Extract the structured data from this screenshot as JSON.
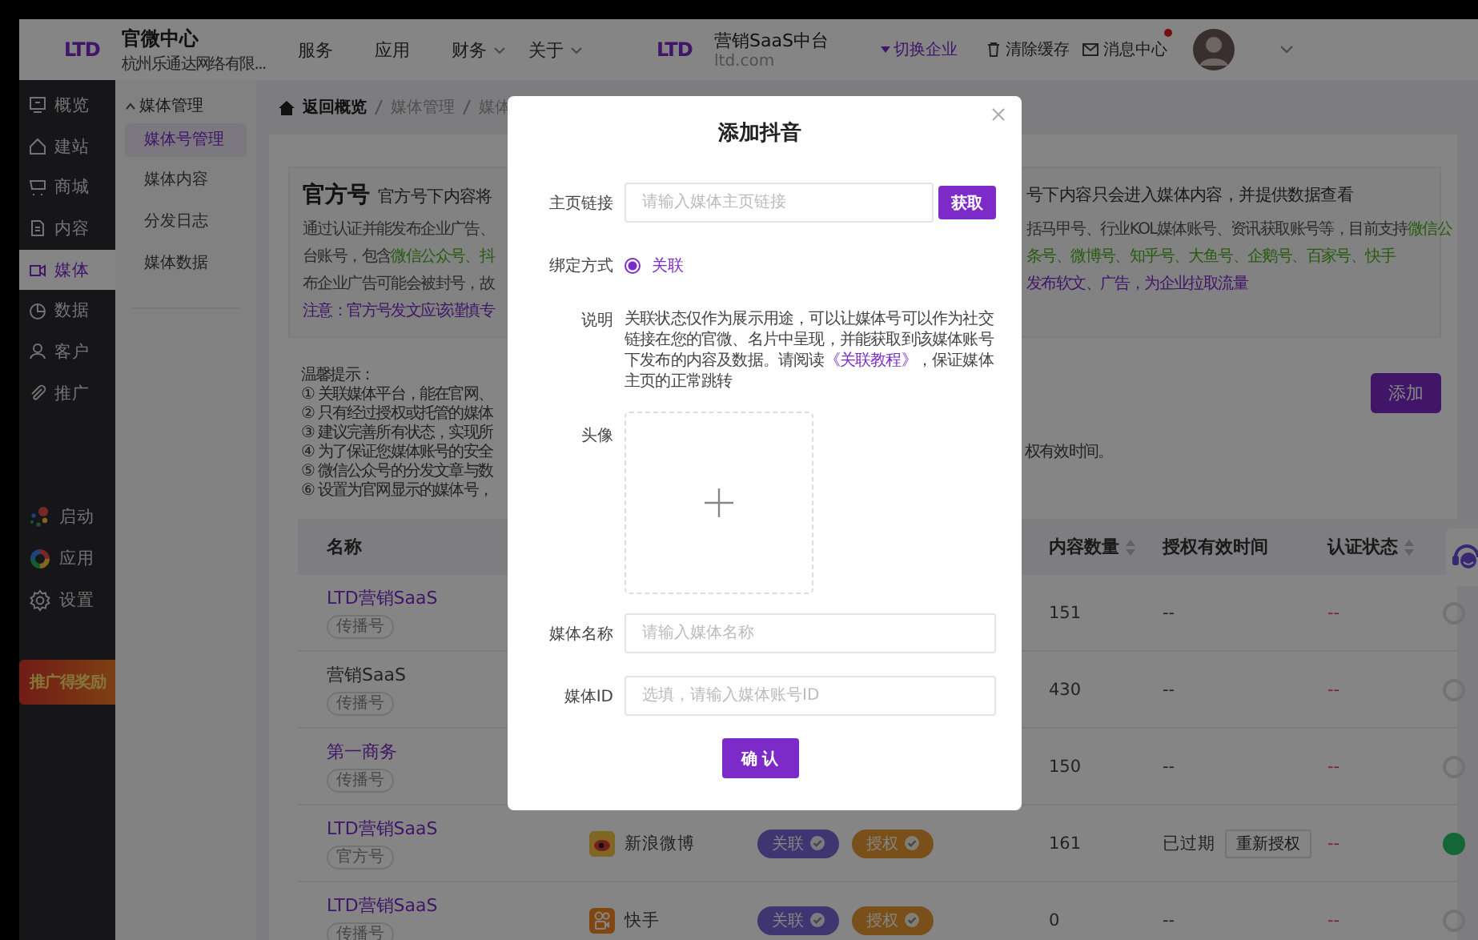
{
  "topbar": {
    "logo": "LTD",
    "brand_title": "官微中心",
    "brand_subtitle": "杭州乐通达网络有限...",
    "nav": [
      {
        "label": "服务",
        "dropdown": false
      },
      {
        "label": "应用",
        "dropdown": false
      },
      {
        "label": "财务",
        "dropdown": true
      },
      {
        "label": "关于",
        "dropdown": true
      }
    ],
    "platform_logo": "LTD",
    "platform_title": "营销SaaS中台",
    "platform_domain": "ltd.com",
    "switch_company": "切换企业",
    "clear_cache": "清除缓存",
    "messages": "消息中心",
    "messages_unread": true
  },
  "sidebar": {
    "items": [
      {
        "label": "概览",
        "selected": false
      },
      {
        "label": "建站",
        "selected": false
      },
      {
        "label": "商城",
        "selected": false
      },
      {
        "label": "内容",
        "selected": false
      },
      {
        "label": "媒体",
        "selected": true
      },
      {
        "label": "数据",
        "selected": false
      },
      {
        "label": "客户",
        "selected": false
      },
      {
        "label": "推广",
        "selected": false
      }
    ],
    "bottom_items": [
      {
        "label": "启动"
      },
      {
        "label": "应用"
      },
      {
        "label": "设置"
      }
    ],
    "promo": "推广得奖励"
  },
  "submenu": {
    "title": "媒体管理",
    "items": [
      {
        "label": "媒体号管理",
        "selected": true
      },
      {
        "label": "媒体内容",
        "selected": false
      },
      {
        "label": "分发日志",
        "selected": false
      },
      {
        "label": "媒体数据",
        "selected": false
      }
    ]
  },
  "breadcrumb": [
    "返回概览",
    "媒体管理",
    "媒体"
  ],
  "intro": {
    "title": "官方号",
    "left_subtitle": "官方号下内容将",
    "right_subtitle": "号下内容只会进入媒体内容，并提供数据查看",
    "lines": [
      {
        "left": [
          {
            "text": "通过认证并能发布企业广告、",
            "kind": "plain"
          }
        ],
        "right": [
          {
            "text": "括马甲号、行业KOL媒体账号、资讯获取账号等，目前支持",
            "kind": "plain"
          },
          {
            "text": "微信公",
            "kind": "green"
          }
        ]
      },
      {
        "left": [
          {
            "text": "台账号，包含",
            "kind": "plain"
          },
          {
            "text": "微信公众号、抖",
            "kind": "green"
          }
        ],
        "right": [
          {
            "text": "条号、微博号、知乎号、大鱼号、企鹅号、百家号、快手",
            "kind": "green"
          }
        ]
      },
      {
        "left": [
          {
            "text": "布企业广告可能会被封号，故",
            "kind": "plain"
          }
        ],
        "right": [
          {
            "text": "发布软文、广告，为企业拉取流量",
            "kind": "purple"
          }
        ]
      },
      {
        "left": [
          {
            "text": "注意：官方号发文应该谨慎专",
            "kind": "purple"
          }
        ]
      }
    ]
  },
  "tips": {
    "title": "温馨提示：",
    "lines": [
      {
        "left": "① 关联媒体平台，能在官网、"
      },
      {
        "left": "② 只有经过授权或托管的媒体"
      },
      {
        "left": "③ 建议完善所有状态，实现所"
      },
      {
        "left": "④ 为了保证您媒体账号的安全",
        "right": "权有效时间。"
      },
      {
        "left": "⑤ 微信公众号的分发文章与数"
      },
      {
        "left": "⑥ 设置为官网显示的媒体号，"
      }
    ]
  },
  "add_button": "添加",
  "table": {
    "columns": [
      {
        "label": "名称",
        "sortable": false
      },
      {
        "label": "内容数量",
        "sortable": true
      },
      {
        "label": "授权有效时间",
        "sortable": false
      },
      {
        "label": "认证状态",
        "sortable": true
      }
    ],
    "rows": [
      {
        "name": "LTD营销SaaS",
        "highlighted": true,
        "tag": "传播号",
        "count": "151",
        "auth_time": "--",
        "status": "--",
        "switch_on": false
      },
      {
        "name": "营销SaaS",
        "highlighted": false,
        "tag": "传播号",
        "count": "430",
        "auth_time": "--",
        "status": "--",
        "switch_on": false
      },
      {
        "name": "第一商务",
        "highlighted": true,
        "tag": "传播号",
        "count": "150",
        "auth_time": "--",
        "status": "--",
        "switch_on": false
      },
      {
        "name": "LTD营销SaaS",
        "highlighted": true,
        "tag": "官方号",
        "platform": {
          "name": "新浪微博",
          "kind": "weibo"
        },
        "badges": [
          {
            "label": "关联",
            "kind": "link"
          },
          {
            "label": "授权",
            "kind": "auth"
          }
        ],
        "count": "161",
        "auth_time": "已过期",
        "reauth": "重新授权",
        "status": "--",
        "switch_on": true
      },
      {
        "name": "LTD营销SaaS",
        "highlighted": true,
        "tag": "传播号",
        "platform": {
          "name": "快手",
          "kind": "kuaishou"
        },
        "badges": [
          {
            "label": "关联",
            "kind": "link"
          },
          {
            "label": "授权",
            "kind": "auth"
          }
        ],
        "count": "0",
        "auth_time": "--",
        "status": "--",
        "switch_on": false
      }
    ]
  },
  "modal": {
    "title": "添加抖音",
    "rows": [
      {
        "kind": "link_input",
        "label": "主页链接",
        "placeholder": "请输入媒体主页链接",
        "button": "获取"
      },
      {
        "kind": "radio",
        "label": "绑定方式",
        "options": [
          {
            "label": "关联",
            "selected": true
          }
        ]
      },
      {
        "kind": "note",
        "label": "说明",
        "before": "关联状态仅作为展示用途，可以让媒体号可以作为社交链接在您的官微、名片中呈现，并能获取到该媒体账号下发布的内容及数据。请阅读",
        "link": "《关联教程》",
        "after": "，保证媒体主页的正常跳转"
      },
      {
        "kind": "upload",
        "label": "头像"
      },
      {
        "kind": "input",
        "label": "媒体名称",
        "placeholder": "请输入媒体名称"
      },
      {
        "kind": "input",
        "label": "媒体ID",
        "placeholder": "选填，请输入媒体账号ID"
      }
    ],
    "confirm": "确 认"
  }
}
